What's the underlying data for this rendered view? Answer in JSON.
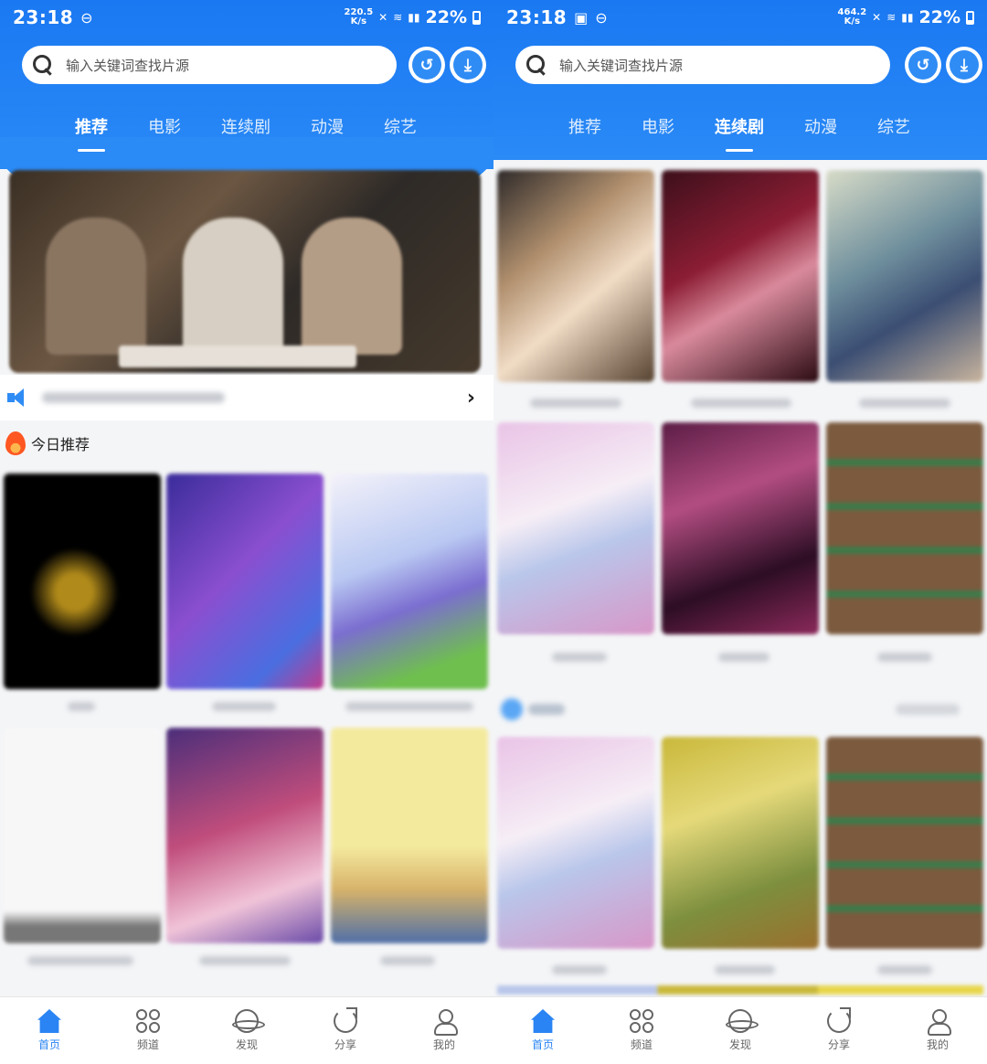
{
  "left": {
    "status": {
      "time": "23:18",
      "speed": "220.5",
      "speed_unit": "K/s",
      "battery": "22%"
    },
    "search": {
      "placeholder": "输入关键词查找片源"
    },
    "tabs": [
      "推荐",
      "电影",
      "连续剧",
      "动漫",
      "综艺"
    ],
    "active_tab": "推荐",
    "section_title": "今日推荐",
    "nav": [
      "首页",
      "频道",
      "发现",
      "分享",
      "我的"
    ]
  },
  "right": {
    "status": {
      "time": "23:18",
      "speed": "464.2",
      "speed_unit": "K/s",
      "battery": "22%"
    },
    "search": {
      "placeholder": "输入关键词查找片源"
    },
    "tabs": [
      "推荐",
      "电影",
      "连续剧",
      "动漫",
      "综艺"
    ],
    "active_tab": "连续剧",
    "nav": [
      "首页",
      "频道",
      "发现",
      "分享",
      "我的"
    ]
  },
  "colors": {
    "brand_blue": "#1a78f2",
    "nav_active": "#2a84f3"
  },
  "icons": [
    "search-icon",
    "history-icon",
    "download-icon",
    "speaker-icon",
    "chevron-right-icon",
    "flame-icon",
    "home-icon",
    "channel-icon",
    "discover-icon",
    "share-icon",
    "me-icon"
  ]
}
